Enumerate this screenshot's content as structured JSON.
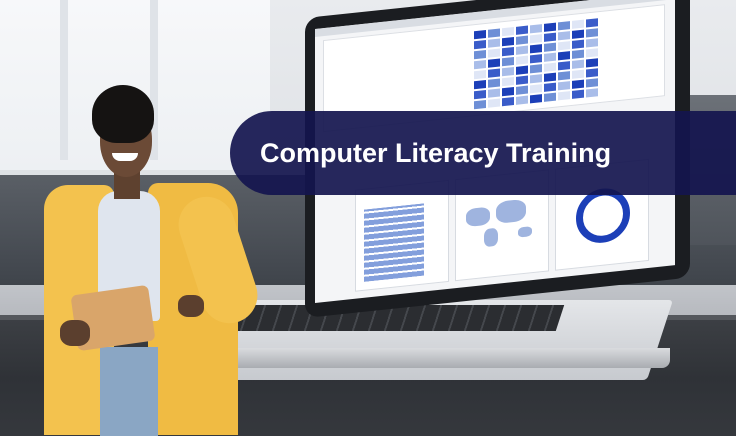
{
  "banner": {
    "title": "Computer Literacy Training"
  },
  "colors": {
    "banner_background": "#14154e",
    "banner_text": "#ffffff",
    "blazer": "#f3c24e",
    "dashboard_accent": "#1c3fb8"
  }
}
